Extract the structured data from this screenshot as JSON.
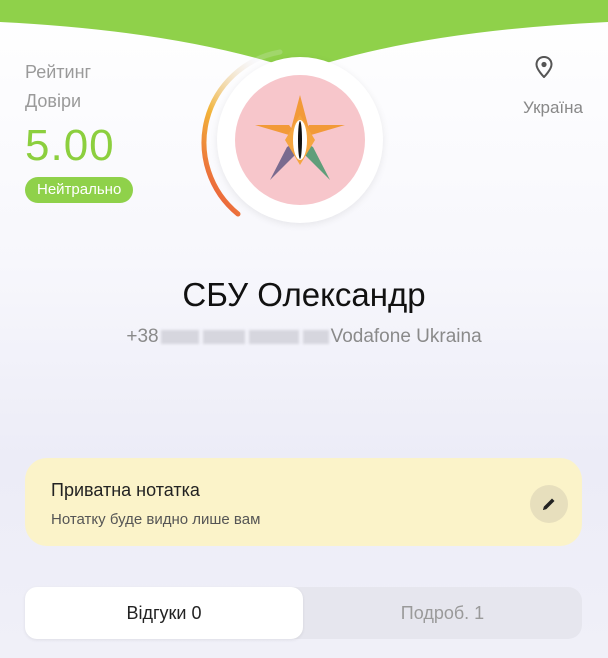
{
  "header": {
    "background_color": "#8fd14a"
  },
  "rating": {
    "label_line1": "Рейтинг",
    "label_line2": "Довіри",
    "value": "5.00",
    "badge": "Нейтрально",
    "accent_color": "#8ccf3e"
  },
  "location": {
    "icon": "location-pin-icon",
    "country": "Україна"
  },
  "profile": {
    "name": "СБУ Олександр",
    "phone_prefix": "+38",
    "operator": "Vodafone Ukraina",
    "avatar_icon": "star-logo-icon"
  },
  "note": {
    "title": "Приватна нотатка",
    "subtitle": "Нотатку буде видно лише вам",
    "edit_icon": "pencil-icon"
  },
  "tabs": [
    {
      "label": "Відгуки 0",
      "active": true
    },
    {
      "label": "Подроб. 1",
      "active": false
    }
  ]
}
